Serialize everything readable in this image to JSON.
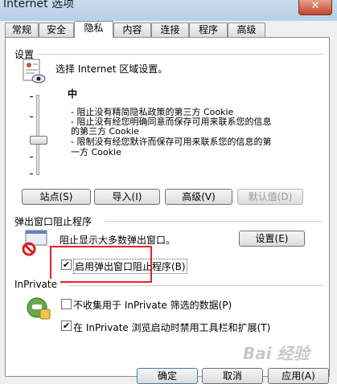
{
  "window": {
    "title": "Internet 选项",
    "close_glyph": "✕"
  },
  "tabs": [
    "常规",
    "安全",
    "隐私",
    "内容",
    "连接",
    "程序",
    "高级"
  ],
  "settings": {
    "group_label": "设置",
    "instruction": "选择 Internet 区域设置。",
    "level": "中",
    "desc": [
      "- 阻止没有精简隐私政策的第三方 Cookie",
      "- 阻止没有经您明确同意而保存可用来联系您的信息",
      "的第三方 Cookie",
      "- 限制没有经您默许而保存可用来联系您的信息的第",
      "一方 Cookie"
    ]
  },
  "buttons": {
    "sites": "站点(S)",
    "import": "导入(I)",
    "advanced": "高级(V)",
    "default": "默认值(D)",
    "popup_settings": "设置(E)"
  },
  "popup": {
    "group_label": "弹出窗口阻止程序",
    "desc": "阻止显示大多数弹出窗口。",
    "checkbox_label": "启用弹出窗口阻止程序(B)",
    "checked": true
  },
  "inprivate": {
    "group_label": "InPrivate",
    "opt1": "不收集用于 InPrivate 筛选的数据(P)",
    "opt1_checked": false,
    "opt2": "在 InPrivate 浏览启动时禁用工具栏和扩展(T)",
    "opt2_checked": true
  },
  "bottom": {
    "ok": "确定",
    "cancel": "取消",
    "apply": "应用(A)"
  },
  "watermark": "Bai 经验"
}
